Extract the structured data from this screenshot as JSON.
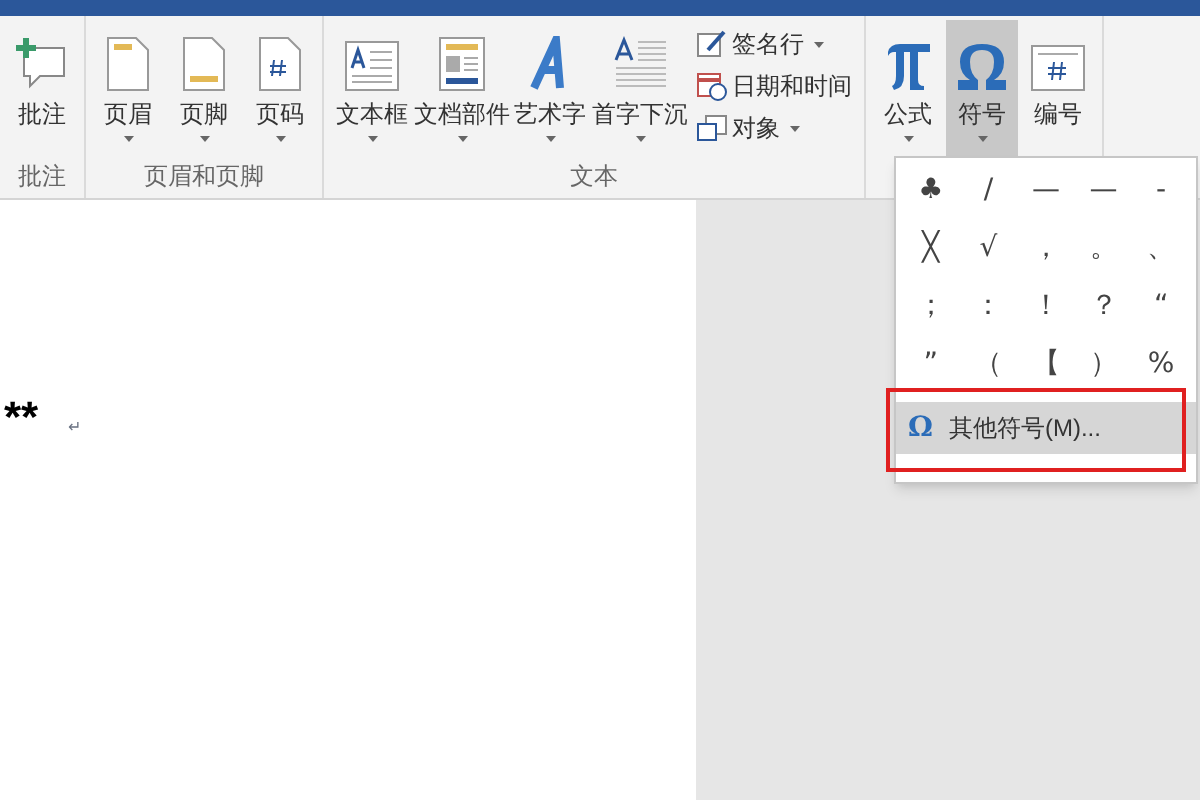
{
  "ribbon": {
    "groups": [
      {
        "label": "批注",
        "buttons": [
          {
            "label": "批注",
            "kind": "comment",
            "dropdown": false,
            "selected": false
          }
        ]
      },
      {
        "label": "页眉和页脚",
        "buttons": [
          {
            "label": "页眉",
            "kind": "header",
            "dropdown": true,
            "selected": false
          },
          {
            "label": "页脚",
            "kind": "footer",
            "dropdown": true,
            "selected": false
          },
          {
            "label": "页码",
            "kind": "pagenum",
            "dropdown": true,
            "selected": false
          }
        ]
      },
      {
        "label": "文本",
        "buttons": [
          {
            "label": "文本框",
            "kind": "textbox",
            "dropdown": true,
            "selected": false
          },
          {
            "label": "文档部件",
            "kind": "parts",
            "dropdown": true,
            "selected": false
          },
          {
            "label": "艺术字",
            "kind": "wordart",
            "dropdown": true,
            "selected": false
          },
          {
            "label": "首字下沉",
            "kind": "dropcap",
            "dropdown": true,
            "selected": false
          },
          {
            "label": "签名行",
            "kind": "signature",
            "dropdown": true,
            "selected": false
          },
          {
            "label": "日期和时间",
            "kind": "datetime",
            "dropdown": false,
            "selected": false
          },
          {
            "label": "对象",
            "kind": "object",
            "dropdown": true,
            "selected": false
          }
        ]
      },
      {
        "buttons": [
          {
            "label": "公式",
            "kind": "equation",
            "dropdown": true,
            "selected": false
          },
          {
            "label": "符号",
            "kind": "symbol",
            "dropdown": true,
            "selected": true
          },
          {
            "label": "编号",
            "kind": "number",
            "dropdown": false,
            "selected": false
          }
        ]
      }
    ]
  },
  "document": {
    "text": "**",
    "paragraph_mark": "↵"
  },
  "symbol_menu": {
    "symbols": [
      "♣",
      "/",
      "—",
      "—",
      "-",
      "╳",
      "√",
      "，",
      "。",
      "、",
      "；",
      "：",
      "！",
      "？",
      "“",
      "”",
      "（",
      "【",
      "）",
      "%"
    ],
    "more": {
      "icon": "Ω",
      "label": "其他符号(M)...",
      "hovered": true,
      "annotated": true
    }
  }
}
